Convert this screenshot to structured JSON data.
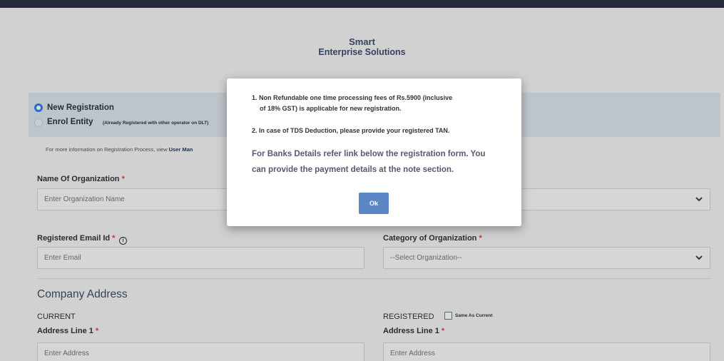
{
  "brand": {
    "line1": "Smart",
    "line2": "Enterprise Solutions"
  },
  "registration": {
    "option_new": "New Registration",
    "option_enrol": "Enrol Entity",
    "enrol_note": "(Already Registered with other operator on DLT)",
    "info_text": "For more information on Registration Process, view ",
    "info_link": "User Man"
  },
  "form": {
    "org_name": {
      "label": "Name Of Organization",
      "required": "*",
      "placeholder": "Enter Organization Name"
    },
    "email": {
      "label": "Registered Email Id",
      "required": "*",
      "info_glyph": "i",
      "placeholder": "Enter Email"
    },
    "category": {
      "label": "Category of Organization",
      "required": "*",
      "selected": "--Select Organization--"
    }
  },
  "address": {
    "section_title": "Company Address",
    "current": {
      "heading": "CURRENT",
      "line1_label": "Address Line 1",
      "required": "*",
      "placeholder": "Enter Address"
    },
    "registered": {
      "heading": "REGISTERED",
      "same_as_current": "Same As Current",
      "line1_label": "Address Line 1",
      "required": "*",
      "placeholder": "Enter Address"
    }
  },
  "modal": {
    "line1a": "1. Non Refundable one time processing fees of Rs.5900 (inclusive",
    "line1b": "of 18% GST) is applicable for new registration.",
    "line2": "2. In case of TDS Deduction, please provide your registered TAN.",
    "bank_a": "For Banks Details refer link below the registration form. You",
    "bank_b": "can provide the payment details at the note section.",
    "ok_label": "Ok"
  },
  "colors": {
    "accent": "#2f80ed",
    "required": "#e0443a",
    "ok_button": "#5b87c7",
    "topbar": "#2b3446"
  }
}
